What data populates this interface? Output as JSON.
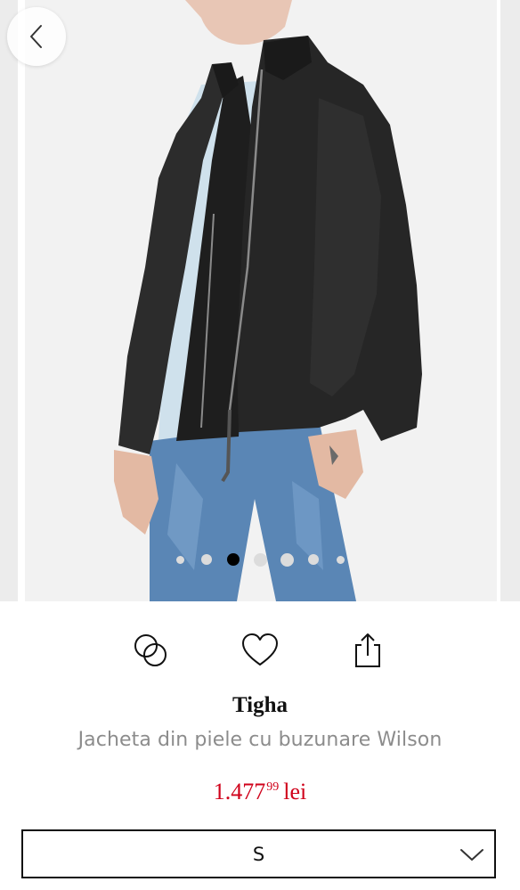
{
  "gallery": {
    "image_alt": "Tigha Jacheta din piele cu buzunare Wilson",
    "dot_count": 7,
    "active_index": 2
  },
  "actions": {
    "compare_icon": "compare-icon",
    "favorite_icon": "heart-icon",
    "share_icon": "share-icon"
  },
  "product": {
    "brand": "Tigha",
    "title": "Jacheta din piele cu buzunare Wilson",
    "price_main": "1.477",
    "price_cents": "99",
    "currency": "lei"
  },
  "size_select": {
    "selected": "S"
  },
  "colors": {
    "price": "#d0021b",
    "text_muted": "#8c8c8c",
    "dot_active": "#000000",
    "dot_inactive": "#dcdcdc"
  }
}
